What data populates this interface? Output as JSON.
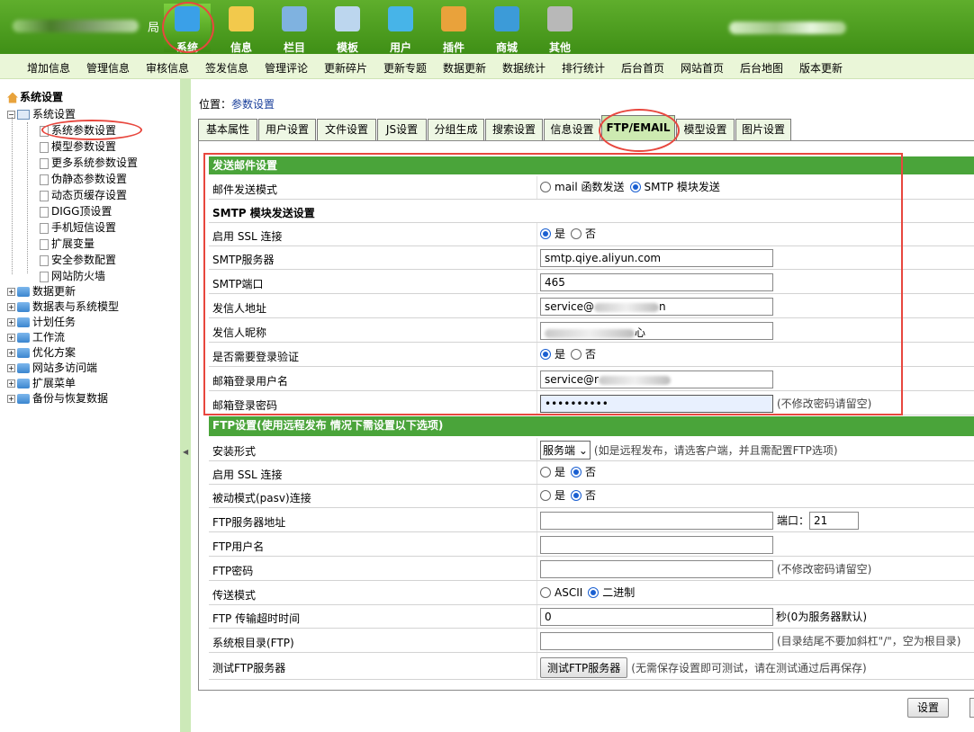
{
  "header": {
    "logo_suffix": "局",
    "nav": [
      {
        "label": "系统",
        "icon": "system-globe-icon",
        "color": "#3aa0e8",
        "active": true
      },
      {
        "label": "信息",
        "icon": "edit-note-icon",
        "color": "#f2c94c"
      },
      {
        "label": "栏目",
        "icon": "folder-icon",
        "color": "#7fb2e0"
      },
      {
        "label": "模板",
        "icon": "template-window-icon",
        "color": "#bcd6ee"
      },
      {
        "label": "用户",
        "icon": "user-icon",
        "color": "#47b4e8"
      },
      {
        "label": "插件",
        "icon": "tools-icon",
        "color": "#e9a23b"
      },
      {
        "label": "商城",
        "icon": "card-icon",
        "color": "#3c9bd8"
      },
      {
        "label": "其他",
        "icon": "gear-icon",
        "color": "#b8b8b8"
      }
    ]
  },
  "subnav": [
    "增加信息",
    "管理信息",
    "审核信息",
    "签发信息",
    "管理评论",
    "更新碎片",
    "更新专题",
    "数据更新",
    "数据统计",
    "排行统计",
    "后台首页",
    "网站首页",
    "后台地图",
    "版本更新"
  ],
  "sidebar": {
    "root": "系统设置",
    "group": "系统设置",
    "children": [
      "系统参数设置",
      "模型参数设置",
      "更多系统参数设置",
      "伪静态参数设置",
      "动态页缓存设置",
      "DIGG顶设置",
      "手机短信设置",
      "扩展变量",
      "安全参数配置",
      "网站防火墙"
    ],
    "folders": [
      "数据更新",
      "数据表与系统模型",
      "计划任务",
      "工作流",
      "优化方案",
      "网站多访问端",
      "扩展菜单",
      "备份与恢复数据"
    ]
  },
  "location": {
    "prefix": "位置：",
    "link": "参数设置"
  },
  "tabs": [
    "基本属性",
    "用户设置",
    "文件设置",
    "JS设置",
    "分组生成",
    "搜索设置",
    "信息设置",
    "FTP/EMAIL",
    "模型设置",
    "图片设置"
  ],
  "email": {
    "section": "发送邮件设置",
    "mode_label": "邮件发送模式",
    "mode_opt1": "mail 函数发送",
    "mode_opt2": "SMTP 模块发送",
    "smtp_section": "SMTP 模块发送设置",
    "ssl_label": "启用 SSL 连接",
    "yes": "是",
    "no": "否",
    "server_label": "SMTP服务器",
    "server_value": "smtp.qiye.aliyun.com",
    "port_label": "SMTP端口",
    "port_value": "465",
    "from_label": "发信人地址",
    "from_value_start": "service@",
    "from_value_end": "n",
    "nick_label": "发信人昵称",
    "nick_value_end": "心",
    "auth_label": "是否需要登录验证",
    "user_label": "邮箱登录用户名",
    "user_value_start": "service@r",
    "pass_label": "邮箱登录密码",
    "pass_value": "••••••••••",
    "pass_hint": "(不修改密码请留空)"
  },
  "ftp": {
    "section": "FTP设置(使用远程发布 情况下需设置以下选项)",
    "install_label": "安装形式",
    "install_value": "服务端",
    "install_hint": "(如是远程发布，请选客户端，并且需配置FTP选项)",
    "ssl_label": "启用 SSL 连接",
    "pasv_label": "被动模式(pasv)连接",
    "host_label": "FTP服务器地址",
    "port_label": "端口：",
    "port_value": "21",
    "user_label": "FTP用户名",
    "pass_label": "FTP密码",
    "pass_hint": "(不修改密码请留空)",
    "mode_label": "传送模式",
    "mode_opt1": "ASCII",
    "mode_opt2": "二进制",
    "timeout_label": "FTP 传输超时时间",
    "timeout_value": "0",
    "timeout_hint": "秒(0为服务器默认)",
    "root_label": "系统根目录(FTP)",
    "root_hint": "(目录结尾不要加斜杠\"/\"，空为根目录)",
    "test_label": "测试FTP服务器",
    "test_button": "测试FTP服务器",
    "test_hint": "(无需保存设置即可测试，请在测试通过后再保存)"
  },
  "footer": {
    "save": "设置"
  },
  "colors": {
    "header_green": "#4a9c20",
    "section_green": "#4aa43a",
    "annotation_red": "#e8473e"
  }
}
